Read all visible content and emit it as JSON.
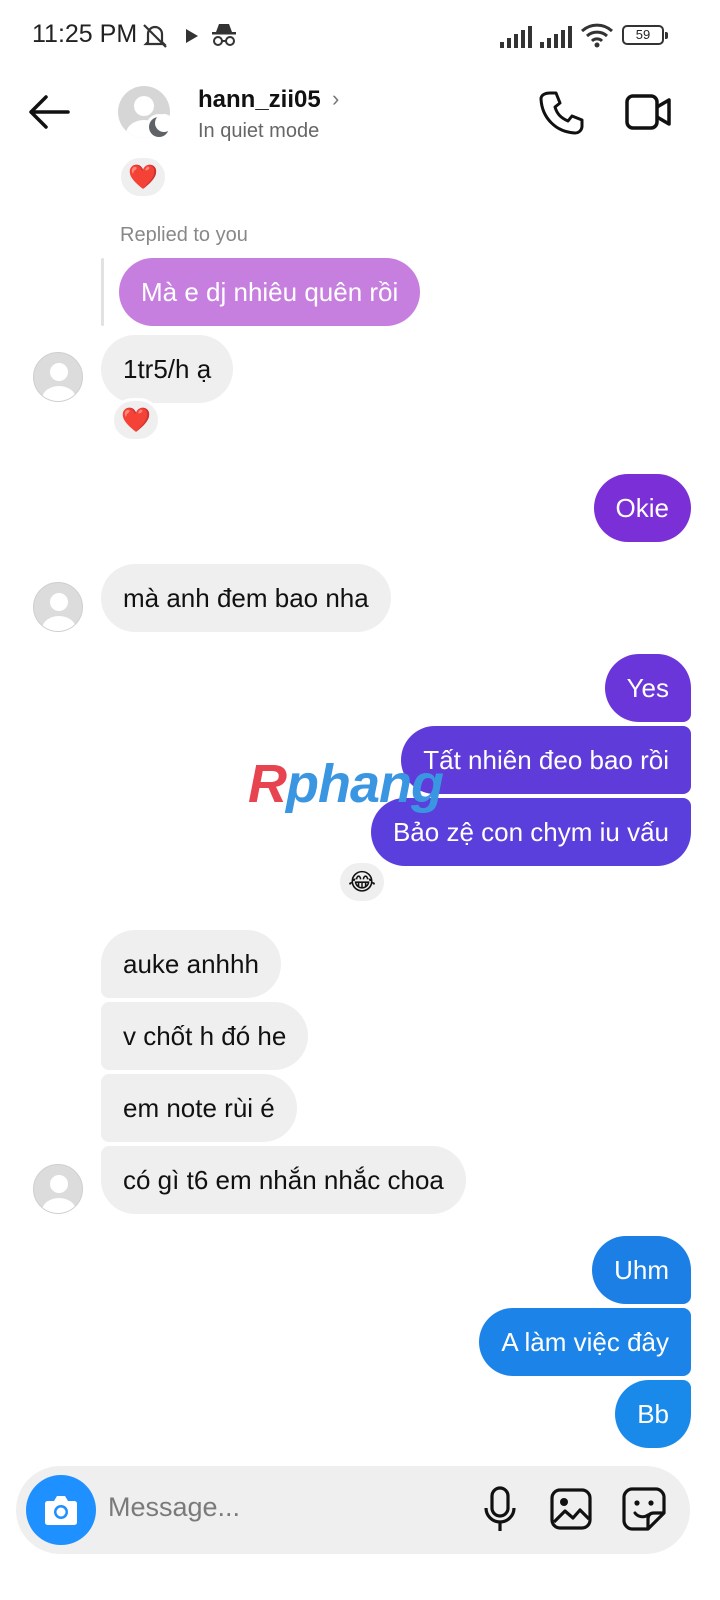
{
  "status_bar": {
    "time": "11:25 PM",
    "battery": "59",
    "icons": [
      "mute-icon",
      "play-icon",
      "incognito-icon",
      "signal-icon",
      "signal-icon",
      "wifi-icon",
      "battery-icon"
    ]
  },
  "header": {
    "username": "hann_zii05",
    "status": "In quiet mode",
    "icons": [
      "back-arrow-icon",
      "chevron-right-icon",
      "phone-icon",
      "video-camera-icon"
    ]
  },
  "messages": {
    "top_reaction": "❤️",
    "reply_label": "Replied to you",
    "reply_text": "Mà e dj nhiêu quên rồi",
    "m1": "1tr5/h ạ",
    "m1_reaction": "❤️",
    "m2": "Okie",
    "m3": "mà anh đem bao nha",
    "m4": "Yes",
    "m5": "Tất nhiên đeo bao rồi",
    "m6": "Bảo zệ con chym iu vấu",
    "m6_reaction": "😂",
    "m7": "auke anhhh",
    "m8": "v chốt h đó he",
    "m9": "em note rùi é",
    "m10": "có gì t6 em nhắn nhắc choa",
    "m11": "Uhm",
    "m12": "A làm việc đây",
    "m13": "Bb"
  },
  "watermark": {
    "first": "R",
    "rest": "phang"
  },
  "composer": {
    "placeholder": "Message...",
    "icons": [
      "camera-icon",
      "microphone-icon",
      "gallery-icon",
      "sticker-icon"
    ]
  },
  "colors": {
    "reply_bubble": "#c67fdf",
    "outgoing_purple": "#7b2fd6",
    "outgoing_indigo": "#5b3fdc",
    "outgoing_blue": "#1c7fe6",
    "incoming_bubble": "#efefef",
    "camera_button": "#1e90ff"
  }
}
